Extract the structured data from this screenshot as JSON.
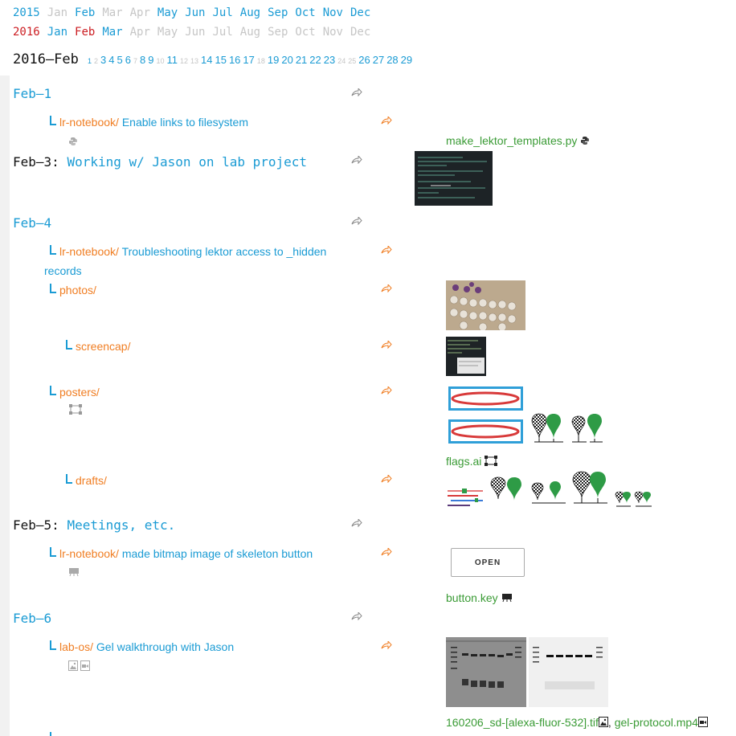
{
  "calendar": {
    "rows": [
      {
        "year": "2015",
        "months": [
          {
            "m": "Jan",
            "state": "inactive"
          },
          {
            "m": "Feb",
            "state": "active"
          },
          {
            "m": "Mar",
            "state": "inactive"
          },
          {
            "m": "Apr",
            "state": "inactive"
          },
          {
            "m": "May",
            "state": "active"
          },
          {
            "m": "Jun",
            "state": "active"
          },
          {
            "m": "Jul",
            "state": "active"
          },
          {
            "m": "Aug",
            "state": "active"
          },
          {
            "m": "Sep",
            "state": "active"
          },
          {
            "m": "Oct",
            "state": "active"
          },
          {
            "m": "Nov",
            "state": "active"
          },
          {
            "m": "Dec",
            "state": "active"
          }
        ]
      },
      {
        "year": "2016",
        "months": [
          {
            "m": "Jan",
            "state": "active"
          },
          {
            "m": "Feb",
            "state": "current"
          },
          {
            "m": "Mar",
            "state": "active"
          },
          {
            "m": "Apr",
            "state": "inactive"
          },
          {
            "m": "May",
            "state": "inactive"
          },
          {
            "m": "Jun",
            "state": "inactive"
          },
          {
            "m": "Jul",
            "state": "inactive"
          },
          {
            "m": "Aug",
            "state": "inactive"
          },
          {
            "m": "Sep",
            "state": "inactive"
          },
          {
            "m": "Oct",
            "state": "inactive"
          },
          {
            "m": "Nov",
            "state": "inactive"
          },
          {
            "m": "Dec",
            "state": "inactive"
          }
        ]
      }
    ]
  },
  "month_heading": "2016–Feb",
  "days": [
    {
      "d": "1",
      "big": false
    },
    {
      "d": "2",
      "big": false,
      "grey": true
    },
    {
      "d": "3",
      "big": true
    },
    {
      "d": "4",
      "big": true
    },
    {
      "d": "5",
      "big": true
    },
    {
      "d": "6",
      "big": true
    },
    {
      "d": "7",
      "big": false,
      "grey": true
    },
    {
      "d": "8",
      "big": true
    },
    {
      "d": "9",
      "big": true
    },
    {
      "d": "10",
      "big": false,
      "grey": true
    },
    {
      "d": "11",
      "big": true
    },
    {
      "d": "12",
      "big": false,
      "grey": true
    },
    {
      "d": "13",
      "big": false,
      "grey": true
    },
    {
      "d": "14",
      "big": true
    },
    {
      "d": "15",
      "big": true
    },
    {
      "d": "16",
      "big": true
    },
    {
      "d": "17",
      "big": true
    },
    {
      "d": "18",
      "big": false,
      "grey": true
    },
    {
      "d": "19",
      "big": true
    },
    {
      "d": "20",
      "big": true
    },
    {
      "d": "21",
      "big": true
    },
    {
      "d": "22",
      "big": true
    },
    {
      "d": "23",
      "big": true
    },
    {
      "d": "24",
      "big": false,
      "grey": true
    },
    {
      "d": "25",
      "big": false,
      "grey": true
    },
    {
      "d": "26",
      "big": true
    },
    {
      "d": "27",
      "big": true
    },
    {
      "d": "28",
      "big": true
    },
    {
      "d": "29",
      "big": true
    }
  ],
  "dates": {
    "feb1": {
      "label": "Feb–1"
    },
    "feb3": {
      "label": "Feb–3:",
      "title": "Working w/ Jason on lab project"
    },
    "feb4": {
      "label": "Feb–4"
    },
    "feb5": {
      "label": "Feb–5:",
      "title": "Meetings, etc."
    },
    "feb6": {
      "label": "Feb–6"
    }
  },
  "entries": {
    "e1": {
      "path": "lr-notebook/",
      "text": "Enable links to filesystem"
    },
    "e2": {
      "path": "lr-notebook/",
      "text": "Troubleshooting lektor access to _hidden",
      "text2": "records"
    },
    "e3": {
      "path": "photos/"
    },
    "e4": {
      "path": "screencap/"
    },
    "e5": {
      "path": "posters/"
    },
    "e6": {
      "path": "drafts/"
    },
    "e7": {
      "path": "lr-notebook/",
      "text": "made bitmap image of skeleton button"
    },
    "e8": {
      "path": "lab-os/",
      "text": "Gel walkthrough with Jason"
    }
  },
  "files": {
    "f1": "make_lektor_templates.py",
    "f2": "flags.ai",
    "f3": "button.key",
    "f4": "160206_sd-[alexa-fluor-532].tif",
    "f4_sep": ",",
    "f5": "gel-protocol.mp4"
  },
  "open_button_label": "OPEN",
  "colors": {
    "link": "#1a9bd4",
    "folder": "#f07e23",
    "file": "#3a9b35",
    "current": "#cc1d22",
    "inactive": "#c6c6c6"
  }
}
